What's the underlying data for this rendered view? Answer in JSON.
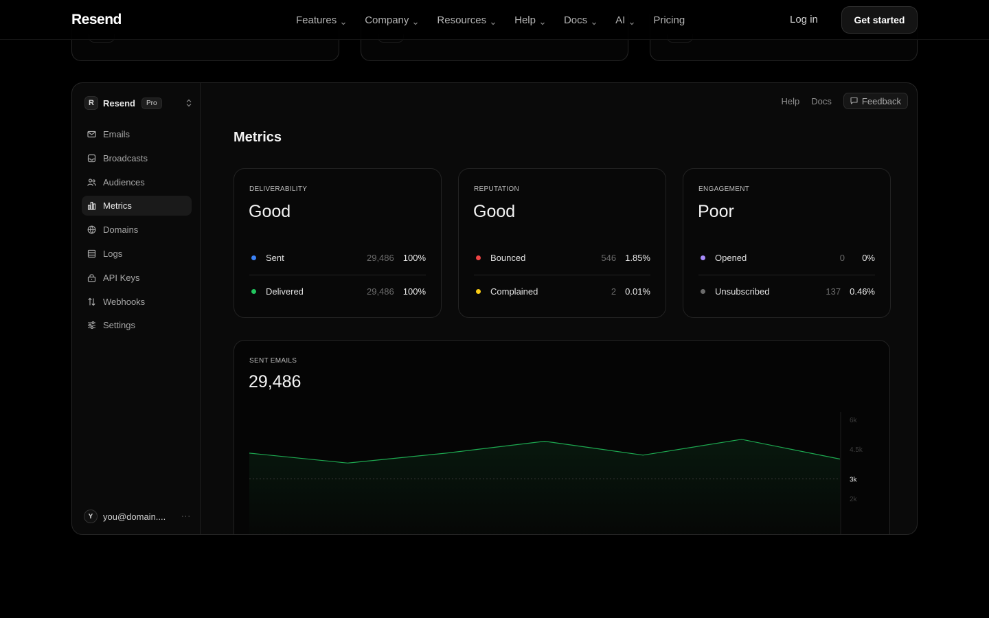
{
  "nav": {
    "logo": "Resend",
    "links": [
      {
        "label": "Features",
        "dropdown": true
      },
      {
        "label": "Company",
        "dropdown": true
      },
      {
        "label": "Resources",
        "dropdown": true
      },
      {
        "label": "Help",
        "dropdown": true
      },
      {
        "label": "Docs",
        "dropdown": true
      },
      {
        "label": "AI",
        "dropdown": true
      },
      {
        "label": "Pricing",
        "dropdown": false
      }
    ],
    "login": "Log in",
    "cta": "Get started"
  },
  "sidebar": {
    "team": {
      "logo_letter": "R",
      "name": "Resend",
      "plan": "Pro"
    },
    "items": [
      {
        "label": "Emails",
        "icon": "mail-icon",
        "active": false
      },
      {
        "label": "Broadcasts",
        "icon": "broadcast-icon",
        "active": false
      },
      {
        "label": "Audiences",
        "icon": "users-icon",
        "active": false
      },
      {
        "label": "Metrics",
        "icon": "bar-chart-icon",
        "active": true
      },
      {
        "label": "Domains",
        "icon": "globe-icon",
        "active": false
      },
      {
        "label": "Logs",
        "icon": "logs-icon",
        "active": false
      },
      {
        "label": "API Keys",
        "icon": "lock-icon",
        "active": false
      },
      {
        "label": "Webhooks",
        "icon": "arrows-icon",
        "active": false
      },
      {
        "label": "Settings",
        "icon": "sliders-icon",
        "active": false
      }
    ],
    "user": {
      "avatar_letter": "Y",
      "email": "you@domain....",
      "more": "···"
    }
  },
  "main": {
    "top_links": [
      "Help",
      "Docs"
    ],
    "feedback": "Feedback",
    "title": "Metrics",
    "cards": [
      {
        "label": "DELIVERABILITY",
        "value": "Good",
        "rows": [
          {
            "name": "Sent",
            "count": "29,486",
            "pct": "100%",
            "color": "#3b82f6"
          },
          {
            "name": "Delivered",
            "count": "29,486",
            "pct": "100%",
            "color": "#22c55e"
          }
        ]
      },
      {
        "label": "REPUTATION",
        "value": "Good",
        "rows": [
          {
            "name": "Bounced",
            "count": "546",
            "pct": "1.85%",
            "color": "#ef4444"
          },
          {
            "name": "Complained",
            "count": "2",
            "pct": "0.01%",
            "color": "#facc15"
          }
        ]
      },
      {
        "label": "ENGAGEMENT",
        "value": "Poor",
        "rows": [
          {
            "name": "Opened",
            "count": "0",
            "pct": "0%",
            "color": "#a78bfa"
          },
          {
            "name": "Unsubscribed",
            "count": "137",
            "pct": "0.46%",
            "color": "#6b6b6b"
          }
        ]
      }
    ],
    "sent_card": {
      "label": "SENT EMAILS",
      "value": "29,486"
    }
  },
  "chart_data": {
    "type": "area",
    "x": [
      0,
      1,
      2,
      3,
      4,
      5,
      6
    ],
    "values": [
      4300,
      3800,
      4300,
      4900,
      4200,
      5000,
      4000
    ],
    "y_ticks": [
      "6k",
      "4.5k",
      "3k",
      "2k"
    ],
    "y_tick_values": [
      6000,
      4500,
      3000,
      2000
    ],
    "highlight_tick": "3k",
    "reference_value": 3000,
    "ylim": [
      0,
      6000
    ],
    "line_color": "#22c55e"
  }
}
